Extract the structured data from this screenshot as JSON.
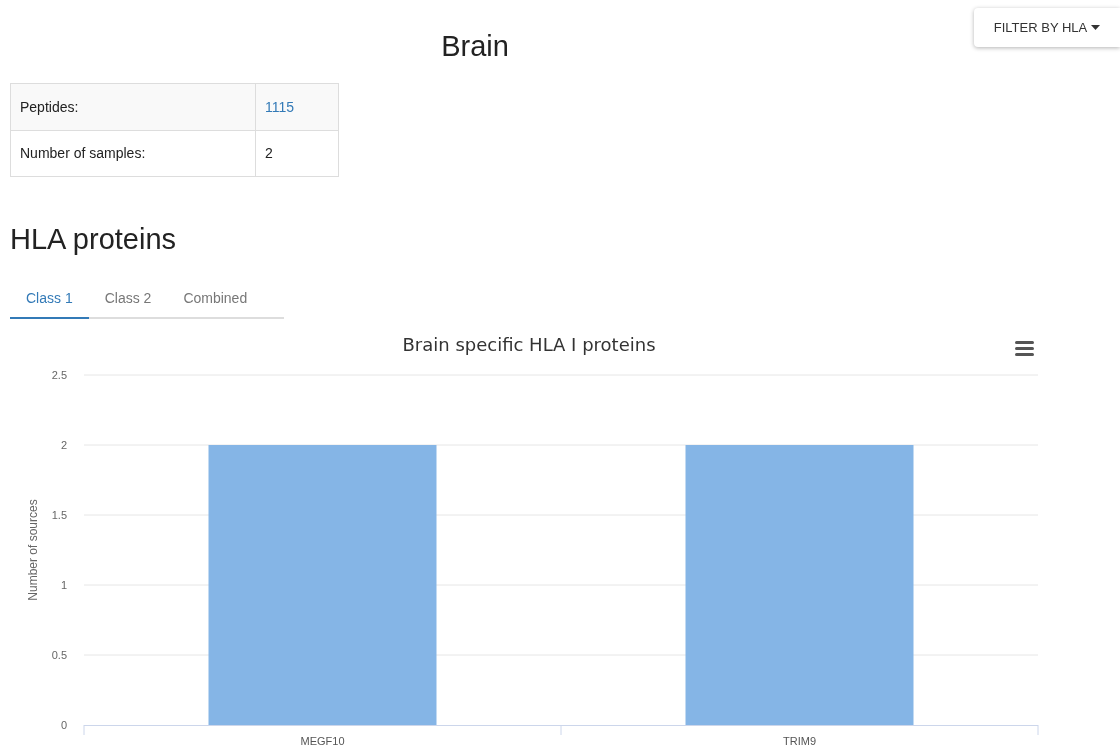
{
  "page_title": "Brain",
  "filter_button": {
    "label": "FILTER BY HLA"
  },
  "summary_table": {
    "rows": [
      {
        "label": "Peptides:",
        "value": "1115",
        "link": true
      },
      {
        "label": "Number of samples:",
        "value": "2",
        "link": false
      }
    ]
  },
  "section_title": "HLA proteins",
  "tabs": [
    {
      "label": "Class 1",
      "selected": true
    },
    {
      "label": "Class 2",
      "selected": false
    },
    {
      "label": "Combined",
      "selected": false
    }
  ],
  "chart": {
    "chart_data": {
      "type": "bar",
      "title": "Brain specific HLA I proteins",
      "ylabel": "Number of sources",
      "categories": [
        "MEGF10",
        "TRIM9"
      ],
      "series": [
        {
          "color": "#85b5e6",
          "values": [
            2,
            2
          ]
        }
      ],
      "grid": true,
      "ylim": [
        0,
        2.5
      ],
      "yticks": [
        0,
        0.5,
        1,
        1.5,
        2,
        2.5
      ]
    }
  }
}
